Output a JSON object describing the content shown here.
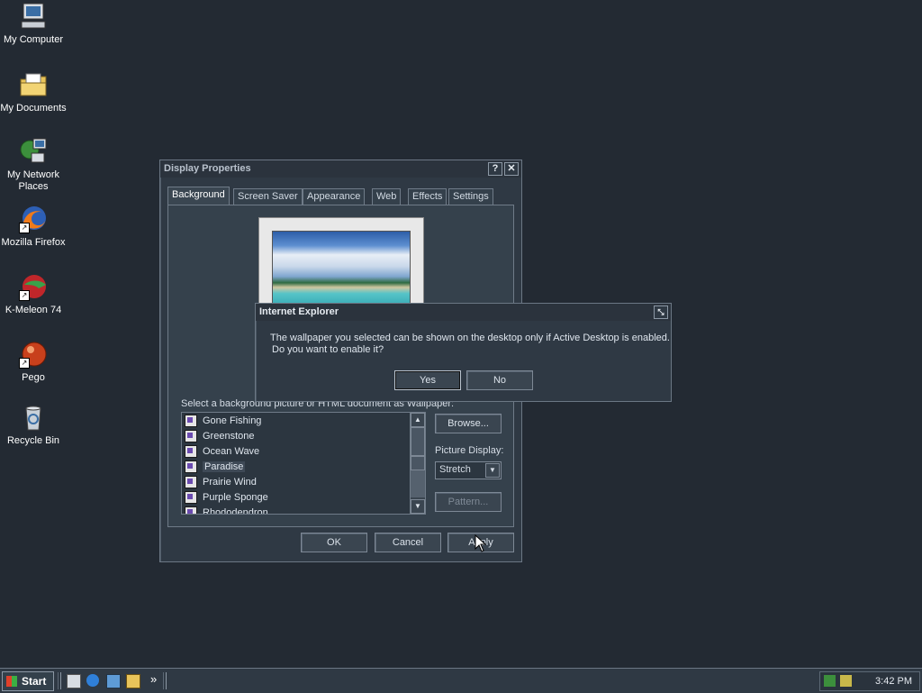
{
  "desktop": {
    "icons": [
      {
        "label": "My Computer"
      },
      {
        "label": "My Documents"
      },
      {
        "label": "My Network Places"
      },
      {
        "label": "Mozilla Firefox"
      },
      {
        "label": "K-Meleon 74"
      },
      {
        "label": "Pego"
      },
      {
        "label": "Recycle Bin"
      }
    ]
  },
  "display_properties": {
    "title": "Display Properties",
    "help_button": "?",
    "close_button": "✕",
    "tabs": [
      "Background",
      "Screen Saver",
      "Appearance",
      "Web",
      "Effects",
      "Settings"
    ],
    "active_tab": "Background",
    "list_caption": "Select a background picture or HTML document as Wallpaper:",
    "wallpapers": [
      "Gone Fishing",
      "Greenstone",
      "Ocean Wave",
      "Paradise",
      "Prairie Wind",
      "Purple Sponge",
      "Rhododendron"
    ],
    "selected_wallpaper": "Paradise",
    "browse_label": "Browse...",
    "picture_display_label": "Picture Display:",
    "picture_display_value": "Stretch",
    "pattern_label": "Pattern...",
    "ok_label": "OK",
    "cancel_label": "Cancel",
    "apply_label": "Apply"
  },
  "ie_dialog": {
    "title": "Internet Explorer",
    "message_line1": "The wallpaper you selected can be shown on the desktop only if Active Desktop is enabled.",
    "message_line2": "Do you want to enable it?",
    "yes_label": "Yes",
    "no_label": "No"
  },
  "taskbar": {
    "start_label": "Start",
    "chevron": "»",
    "clock": "3:42 PM"
  },
  "colors": {
    "desktop": "#232a33",
    "window": "#2f3944"
  }
}
